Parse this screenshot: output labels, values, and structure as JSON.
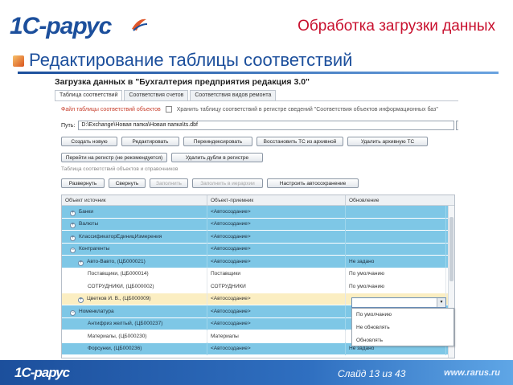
{
  "slide": {
    "logo": "1С-рарус",
    "header_title": "Обработка загрузки данных",
    "subtitle": "Редактирование таблицы соответствий"
  },
  "app": {
    "title": "Загрузка данных в \"Бухгалтерия предприятия редакция 3.0\"",
    "tabs": [
      "Таблица соответствий",
      "Соответствия счетов",
      "Соответствия видов ремонта"
    ],
    "file_label": "Файл таблицы соответствий объектов",
    "store_label": "Хранить таблицу соответствий в регистре сведений \"Соответствия объектов информационных баз\"",
    "path_label": "Путь:",
    "path_value": "D:\\Exchange\\Новая папка\\Новая папка\\ts.dbf",
    "path_btn": "...",
    "buttons_row1": [
      "Создать новую",
      "Редактировать",
      "Переиндексировать",
      "Восстановить ТС из архивной",
      "Удалить архивную ТС"
    ],
    "buttons_row2": [
      "Перейти на регистр (не рекомендуется)",
      "Удалить дубли в регистре"
    ],
    "group_label": "Таблица соответствий объектов и справочников",
    "buttons_row3": [
      "Развернуть",
      "Свернуть",
      "Заполнить",
      "Заполнить в иерархии",
      "Настроить автосохранение"
    ],
    "grid": {
      "headers": [
        "Объект источник",
        "Объект-приемник",
        "Обновление"
      ],
      "rows": [
        {
          "c1": "Банки",
          "c2": "<Автосоздание>",
          "c3": ""
        },
        {
          "c1": "Валюты",
          "c2": "<Автосоздание>",
          "c3": ""
        },
        {
          "c1": "КлассификаторЕдиницИзмерения",
          "c2": "<Автосоздание>",
          "c3": ""
        },
        {
          "c1": "Контрагенты",
          "c2": "<Автосоздание>",
          "c3": ""
        },
        {
          "c1": "Авто-Вавто, (ЦБ000021)",
          "c2": "<Автосоздание>",
          "c3": "Не задано"
        },
        {
          "c1": "Поставщики, (ЦБ000014)",
          "c2": "Поставщики",
          "c3": "По умолчанию"
        },
        {
          "c1": "СОТРУДНИКИ, (ЦБ000002)",
          "c2": "СОТРУДНИКИ",
          "c3": "По умолчанию"
        },
        {
          "c1": "Цветков И. В., (ЦБ000009)",
          "c2": "<Автосоздание>",
          "c3": ""
        },
        {
          "c1": "Номенклатура",
          "c2": "<Автосоздание>",
          "c3": ""
        },
        {
          "c1": "Антифриз желтый, (ЦБ000237)",
          "c2": "<Автосоздание>",
          "c3": ""
        },
        {
          "c1": "Материалы, (ЦБ000230)",
          "c2": "Материалы",
          "c3": ""
        },
        {
          "c1": "Форсунки, (ЦБ000236)",
          "c2": "<Автосоздание>",
          "c3": "Не задано"
        }
      ]
    },
    "dropdown": {
      "value": "",
      "arrow": "▾",
      "options": [
        "По умолчанию",
        "Не обновлять",
        "Обновлять"
      ]
    }
  },
  "footer": {
    "logo": "1С-рарус",
    "slide_counter": "Слайд 13 из 43",
    "url": "www.rarus.ru"
  },
  "colors": {
    "brand_blue": "#1c4f9c",
    "title_red": "#c8102e",
    "row_selected": "#7ec7e6",
    "row_current": "#fbeec2"
  }
}
